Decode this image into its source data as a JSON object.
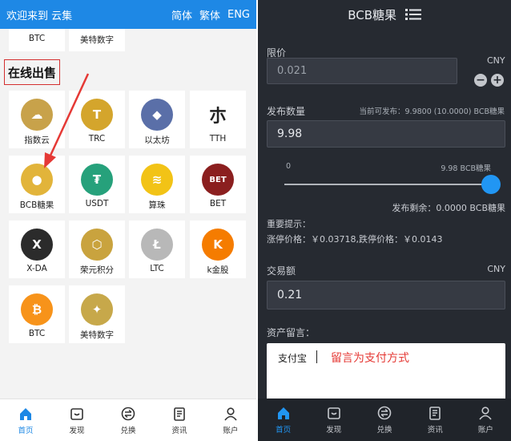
{
  "left": {
    "header": {
      "welcome": "欢迎来到 云集",
      "lang_simplified": "简体",
      "lang_traditional": "繁体",
      "lang_english": "ENG"
    },
    "top_partial": [
      "BTC",
      "美特数字"
    ],
    "section_title": "在线出售",
    "coins": [
      {
        "name": "指数云",
        "icon": "coin-icon",
        "color": "#c8a24a",
        "glyph": "☁"
      },
      {
        "name": "TRC",
        "icon": "coin-icon",
        "color": "#d4a52c",
        "glyph": "T"
      },
      {
        "name": "以太坊",
        "icon": "ethereum-icon",
        "color": "#5a6fa8",
        "glyph": "◆"
      },
      {
        "name": "TTH",
        "icon": "tth-icon",
        "color": "#ffffff",
        "glyph": "朩"
      },
      {
        "name": "BCB糖果",
        "icon": "coin-icon",
        "color": "#e2b43a",
        "glyph": "●"
      },
      {
        "name": "USDT",
        "icon": "tether-icon",
        "color": "#26a17b",
        "glyph": "₮"
      },
      {
        "name": "算珠",
        "icon": "abacus-icon",
        "color": "#f2c316",
        "glyph": "≋"
      },
      {
        "name": "BET",
        "icon": "bet-chip-icon",
        "color": "#8b1f1f",
        "glyph": "BET"
      },
      {
        "name": "X-DA",
        "icon": "xda-icon",
        "color": "#2b2b2b",
        "glyph": "X"
      },
      {
        "name": "荣元积分",
        "icon": "hexagon-icon",
        "color": "#c9a33e",
        "glyph": "⬡"
      },
      {
        "name": "LTC",
        "icon": "litecoin-icon",
        "color": "#b8b8b8",
        "glyph": "Ł"
      },
      {
        "name": "k金股",
        "icon": "k-icon",
        "color": "#f57c00",
        "glyph": "K"
      },
      {
        "name": "BTC",
        "icon": "bitcoin-icon",
        "color": "#f7931a",
        "glyph": "₿"
      },
      {
        "name": "美特数字",
        "icon": "coin-icon",
        "color": "#c7a84a",
        "glyph": "✦"
      }
    ],
    "tabs": [
      "首页",
      "发现",
      "兑换",
      "资讯",
      "账户"
    ]
  },
  "right": {
    "title": "BCB糖果",
    "limit_label": "限价",
    "limit_value": "0.021",
    "currency": "CNY",
    "qty_label": "发布数量",
    "qty_available": "当前可发布：9.9800 (10.0000) BCB糖果",
    "qty_value": "9.98",
    "slider_min": "0",
    "slider_max_label": "9.98 BCB糖果",
    "slider_fraction": 1.0,
    "remaining": "发布剩余：0.0000 BCB糖果",
    "notice_title": "重要提示：",
    "notice_text": "涨停价格：￥0.03718,跌停价格：￥0.0143",
    "amount_label": "交易额",
    "amount_currency": "CNY",
    "amount_value": "0.21",
    "note_label": "资产留言：",
    "note_value": "支付宝",
    "note_annotation": "留言为支付方式",
    "tabs": [
      "首页",
      "发现",
      "兑换",
      "资讯",
      "账户"
    ]
  },
  "colors": {
    "accent": "#1e88e5",
    "arrow": "#e53935",
    "dark_bg": "#262a31"
  }
}
